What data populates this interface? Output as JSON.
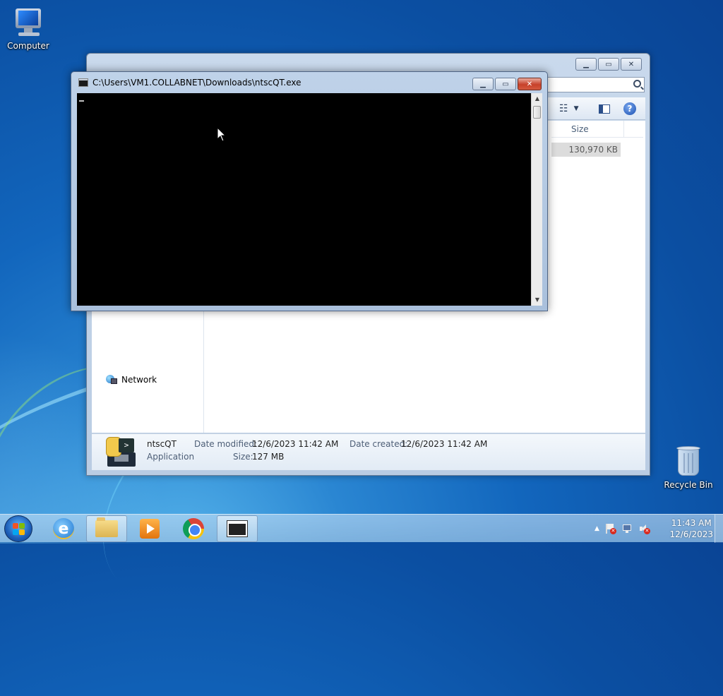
{
  "desktop": {
    "icons": [
      {
        "label": "Computer",
        "icon": "computer-icon"
      },
      {
        "label": "Recycle Bin",
        "icon": "recycle-bin-icon"
      }
    ]
  },
  "explorer": {
    "caption_buttons": {
      "minimize": "minimize-icon",
      "maximize": "maximize-icon",
      "close": "close-icon"
    },
    "search_icon": "search-icon",
    "toolbar": {
      "views_icon": "views-icon",
      "preview_pane_icon": "preview-pane-icon",
      "help_icon": "help-icon",
      "help_glyph": "?"
    },
    "columns": {
      "size": "Size"
    },
    "rows": [
      {
        "size": "130,970 KB"
      }
    ],
    "nav": {
      "network": "Network"
    },
    "details": {
      "name": "ntscQT",
      "type": "Application",
      "date_modified_label": "Date modified:",
      "date_modified": "12/6/2023 11:42 AM",
      "size_label": "Size:",
      "size": "127 MB",
      "date_created_label": "Date created:",
      "date_created": "12/6/2023 11:42 AM"
    }
  },
  "console": {
    "title": "C:\\Users\\VM1.COLLABNET\\Downloads\\ntscQT.exe",
    "close_glyph": "✕"
  },
  "taskbar": {
    "apps": [
      {
        "name": "internet-explorer",
        "active": false
      },
      {
        "name": "file-explorer",
        "active": true
      },
      {
        "name": "media-player",
        "active": false
      },
      {
        "name": "chrome",
        "active": false
      },
      {
        "name": "console",
        "active": true
      }
    ],
    "time": "11:43 AM",
    "date": "12/6/2023"
  }
}
